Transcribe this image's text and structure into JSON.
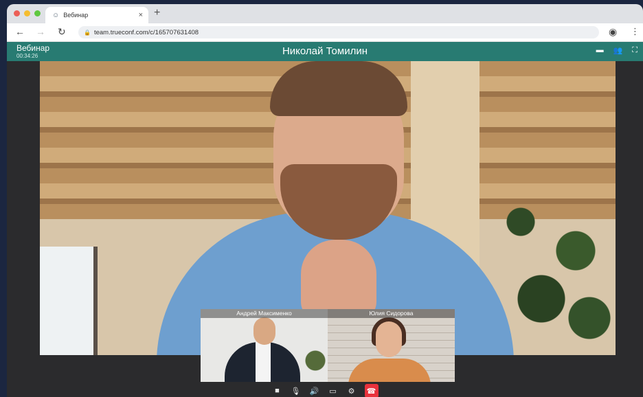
{
  "browser": {
    "tab_title": "Вебинар",
    "tab_close": "×",
    "new_tab": "+",
    "url": "team.trueconf.com/c/165707631408",
    "icons": {
      "back": "←",
      "forward": "→",
      "reload": "↻",
      "lock": "🔒",
      "profile": "◉",
      "menu": "⋮",
      "favicon": "☺"
    }
  },
  "conference": {
    "title": "Вебинар",
    "timer": "00:34:26",
    "speaker": "Николай Томилин",
    "accent": "#288278",
    "top_icons": {
      "chat": "▬",
      "participants": "👥",
      "fullscreen": "⛶"
    },
    "participants": [
      {
        "name": "Андрей Максименко"
      },
      {
        "name": "Юлия Сидорова"
      }
    ],
    "controls": {
      "camera": "■",
      "mic": "🎙",
      "speaker": "🔊",
      "screen": "▭",
      "settings": "⚙",
      "hangup": "☎"
    },
    "hangup_color": "#e8323c"
  }
}
